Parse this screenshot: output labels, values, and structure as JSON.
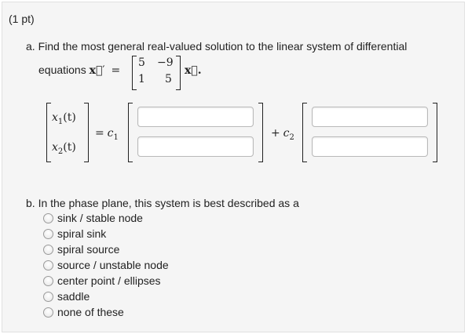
{
  "points": "(1 pt)",
  "part_a": {
    "prompt": "a. Find the most general real-valued solution to the linear system of differential",
    "equations_word": "equations",
    "lhs_var": "x⃗",
    "prime": "′",
    "equals": "=",
    "matrix": [
      [
        "5",
        "−9"
      ],
      [
        "1",
        "5"
      ]
    ],
    "rhs_var": "x⃗",
    "period": "."
  },
  "solution": {
    "x1": "x",
    "x1_sub": "1",
    "x1_arg": "(t)",
    "x2": "x",
    "x2_sub": "2",
    "x2_arg": "(t)",
    "eq_c1": "=",
    "c": "c",
    "c1_sub": "1",
    "plus": "+",
    "c2_sub": "2",
    "inputs": {
      "c1_top": "",
      "c1_bottom": "",
      "c2_top": "",
      "c2_bottom": ""
    }
  },
  "part_b": {
    "prompt": "b. In the phase plane, this system is best described as a",
    "options": [
      "sink / stable node",
      "spiral sink",
      "spiral source",
      "source / unstable node",
      "center point / ellipses",
      "saddle",
      "none of these"
    ]
  }
}
